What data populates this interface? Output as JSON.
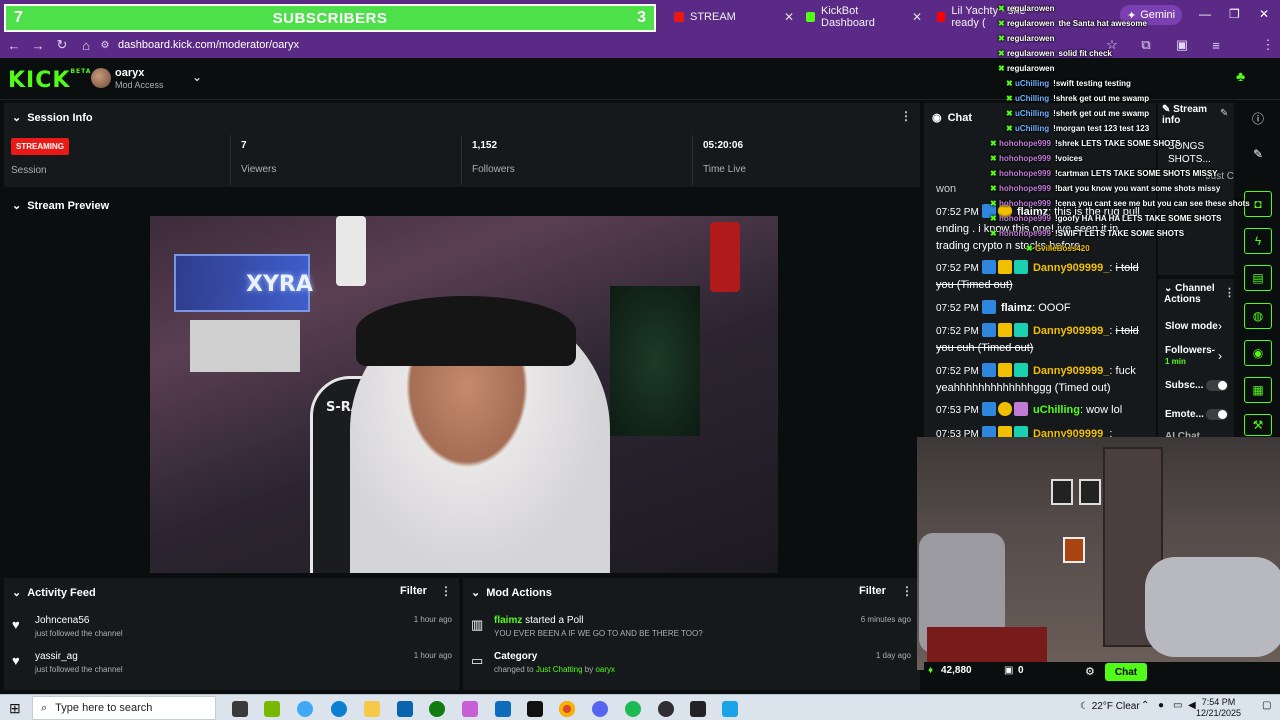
{
  "browser": {
    "subscribers": {
      "left": "7",
      "label": "SUBSCRIBERS",
      "right": "3"
    },
    "tabs": [
      {
        "label": "STREAM",
        "color": "#e91916"
      },
      {
        "label": "KickBot Dashboard",
        "color": "#53fc18"
      },
      {
        "label": "Lil Yachty - she ready (",
        "color": "#ff0000"
      }
    ],
    "gemini": "Gemini",
    "url": "dashboard.kick.com/moderator/oaryx"
  },
  "header": {
    "logo": "KICK",
    "logo_sup": "BETA",
    "user": "oaryx",
    "role": "Mod Access"
  },
  "session": {
    "title": "Session Info",
    "badge": "STREAMING",
    "badge_label": "Session",
    "viewers_value": "7",
    "viewers_label": "Viewers",
    "followers_value": "1,152",
    "followers_label": "Followers",
    "time_value": "05:20:06",
    "time_label": "Time Live"
  },
  "preview": {
    "title": "Stream Preview",
    "neon_text": "XYRA",
    "chair_text": "S-RACER"
  },
  "activity": {
    "title": "Activity Feed",
    "filter": "Filter",
    "rows": [
      {
        "name": "Johncena56",
        "sub": "just followed the channel",
        "time": "1 hour ago"
      },
      {
        "name": "yassir_ag",
        "sub": "just followed the channel",
        "time": "1 hour ago"
      }
    ]
  },
  "modactions": {
    "title": "Mod Actions",
    "filter": "Filter",
    "row1": {
      "user": "flaimz",
      "action": "started a Poll",
      "sub": "YOU EVER BEEN A IF WE GO TO AND BE THERE TOO?",
      "time": "6 minutes ago"
    },
    "row2": {
      "title": "Category",
      "pre": "changed to",
      "cat": "Just Chatting",
      "by": "by",
      "user": "oaryx",
      "time": "1 day ago"
    }
  },
  "chat": {
    "title": "Chat",
    "partial_top": "won",
    "lines": [
      {
        "time": "07:52 PM",
        "user": "flaimz",
        "ucolor": "#ffffff",
        "text": "this is the rug pull ending . i know this one! ive seen it in trading crypto n stocks before."
      },
      {
        "time": "07:52 PM",
        "user": "Danny909999_",
        "ucolor": "#f0c000",
        "text": "i told you (Timed out)"
      },
      {
        "time": "07:52 PM",
        "user": "flaimz",
        "ucolor": "#ffffff",
        "text": "OOOF"
      },
      {
        "time": "07:52 PM",
        "user": "Danny909999_",
        "ucolor": "#f0c000",
        "text": "i told you cuh (Timed out)"
      },
      {
        "time": "07:52 PM",
        "user": "Danny909999_",
        "ucolor": "#f0c000",
        "text": "fuck yeahhhhhhhhhhhhhggg (Timed out)"
      },
      {
        "time": "07:53 PM",
        "user": "uChilling",
        "ucolor": "#53fc18",
        "text": "wow lol"
      },
      {
        "time": "07:53 PM",
        "user": "Danny909999_",
        "ucolor": "#f0c000",
        "text": ""
      }
    ]
  },
  "streaminfo": {
    "title": "Stream info",
    "text": "SONGS SHOTS...",
    "partial": "Just C"
  },
  "channelactions": {
    "title": "Channel Actions",
    "slow": "Slow mode",
    "followers": "Followers-",
    "followers_sub": "1 min",
    "subs": "Subsc...",
    "emote": "Emote...",
    "partial": "AI Chat"
  },
  "chatbar": {
    "kicks": "42,880",
    "zero": "0",
    "chat_btn": "Chat"
  },
  "overlay_lines": [
    {
      "user": "regularowen",
      "msg": "",
      "color": "#ffffff"
    },
    {
      "user": "regularowen",
      "msg": "the Santa hat awesome",
      "color": "#ffffff"
    },
    {
      "user": "regularowen",
      "msg": "",
      "color": "#ffffff"
    },
    {
      "user": "regularowen",
      "msg": "solid fit check",
      "color": "#ffffff"
    },
    {
      "user": "regularowen",
      "msg": "",
      "color": "#ffffff"
    },
    {
      "user": "uChilling",
      "msg": "!swift testing testing",
      "color": "#6fb0ff"
    },
    {
      "user": "uChilling",
      "msg": "!shrek get out me swamp",
      "color": "#6fb0ff"
    },
    {
      "user": "uChilling",
      "msg": "!sherk get out me swamp",
      "color": "#6fb0ff"
    },
    {
      "user": "uChilling",
      "msg": "!morgan test 123 test 123",
      "color": "#6fb0ff"
    },
    {
      "user": "hohohope999",
      "msg": "!shrek LETS TAKE SOME SHOTS",
      "color": "#c07bd6"
    },
    {
      "user": "hohohope999",
      "msg": "!voices",
      "color": "#c07bd6"
    },
    {
      "user": "hohohope999",
      "msg": "!cartman LETS TAKE SOME SHOTS MISSY",
      "color": "#c07bd6"
    },
    {
      "user": "hohohope999",
      "msg": "!bart you know you want some shots missy",
      "color": "#c07bd6"
    },
    {
      "user": "hohohope999",
      "msg": "!cena you cant see me but you can see these shots",
      "color": "#c07bd6"
    },
    {
      "user": "hohohope999",
      "msg": "!goofy HA HA HA LETS TAKE SOME SHOTS",
      "color": "#c07bd6"
    },
    {
      "user": "hohohope999",
      "msg": "!SWIFT LETS TAKE SOME SHOTS",
      "color": "#c07bd6"
    },
    {
      "user": "GvilleBoss420",
      "msg": "",
      "color": "#f0c000"
    }
  ],
  "taskbar": {
    "search": "Type here to search",
    "weather": "22°F  Clear",
    "time": "7:54 PM",
    "date": "12/21/2025"
  }
}
